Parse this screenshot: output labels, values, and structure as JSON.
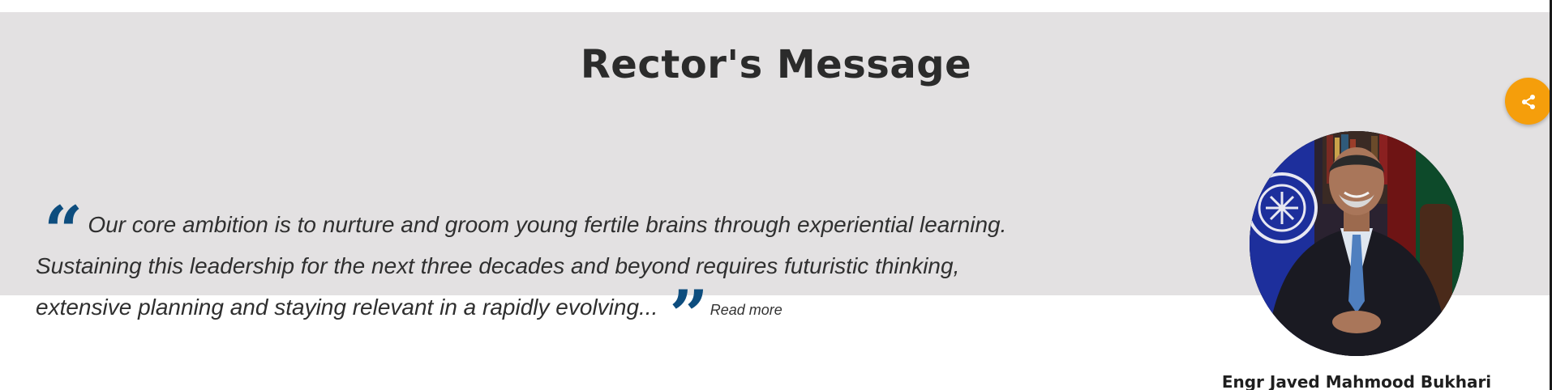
{
  "section": {
    "title": "Rector's Message"
  },
  "quote": {
    "line1": "Our core ambition is to nurture and groom young fertile brains through experiential learning.",
    "line2": "Sustaining this leadership for the next three decades and beyond requires futuristic thinking,",
    "line3": "extensive planning and staying relevant in a rapidly evolving...",
    "open_mark": "“",
    "close_mark": "”",
    "read_more_label": "Read more"
  },
  "rector": {
    "name": "Engr Javed Mahmood Bukhari"
  },
  "share": {
    "icon": "share-icon"
  },
  "colors": {
    "band": "#e3e1e2",
    "quote_mark": "#0d4d7e",
    "share_button": "#f59e0b",
    "title": "#2b2b2b"
  }
}
